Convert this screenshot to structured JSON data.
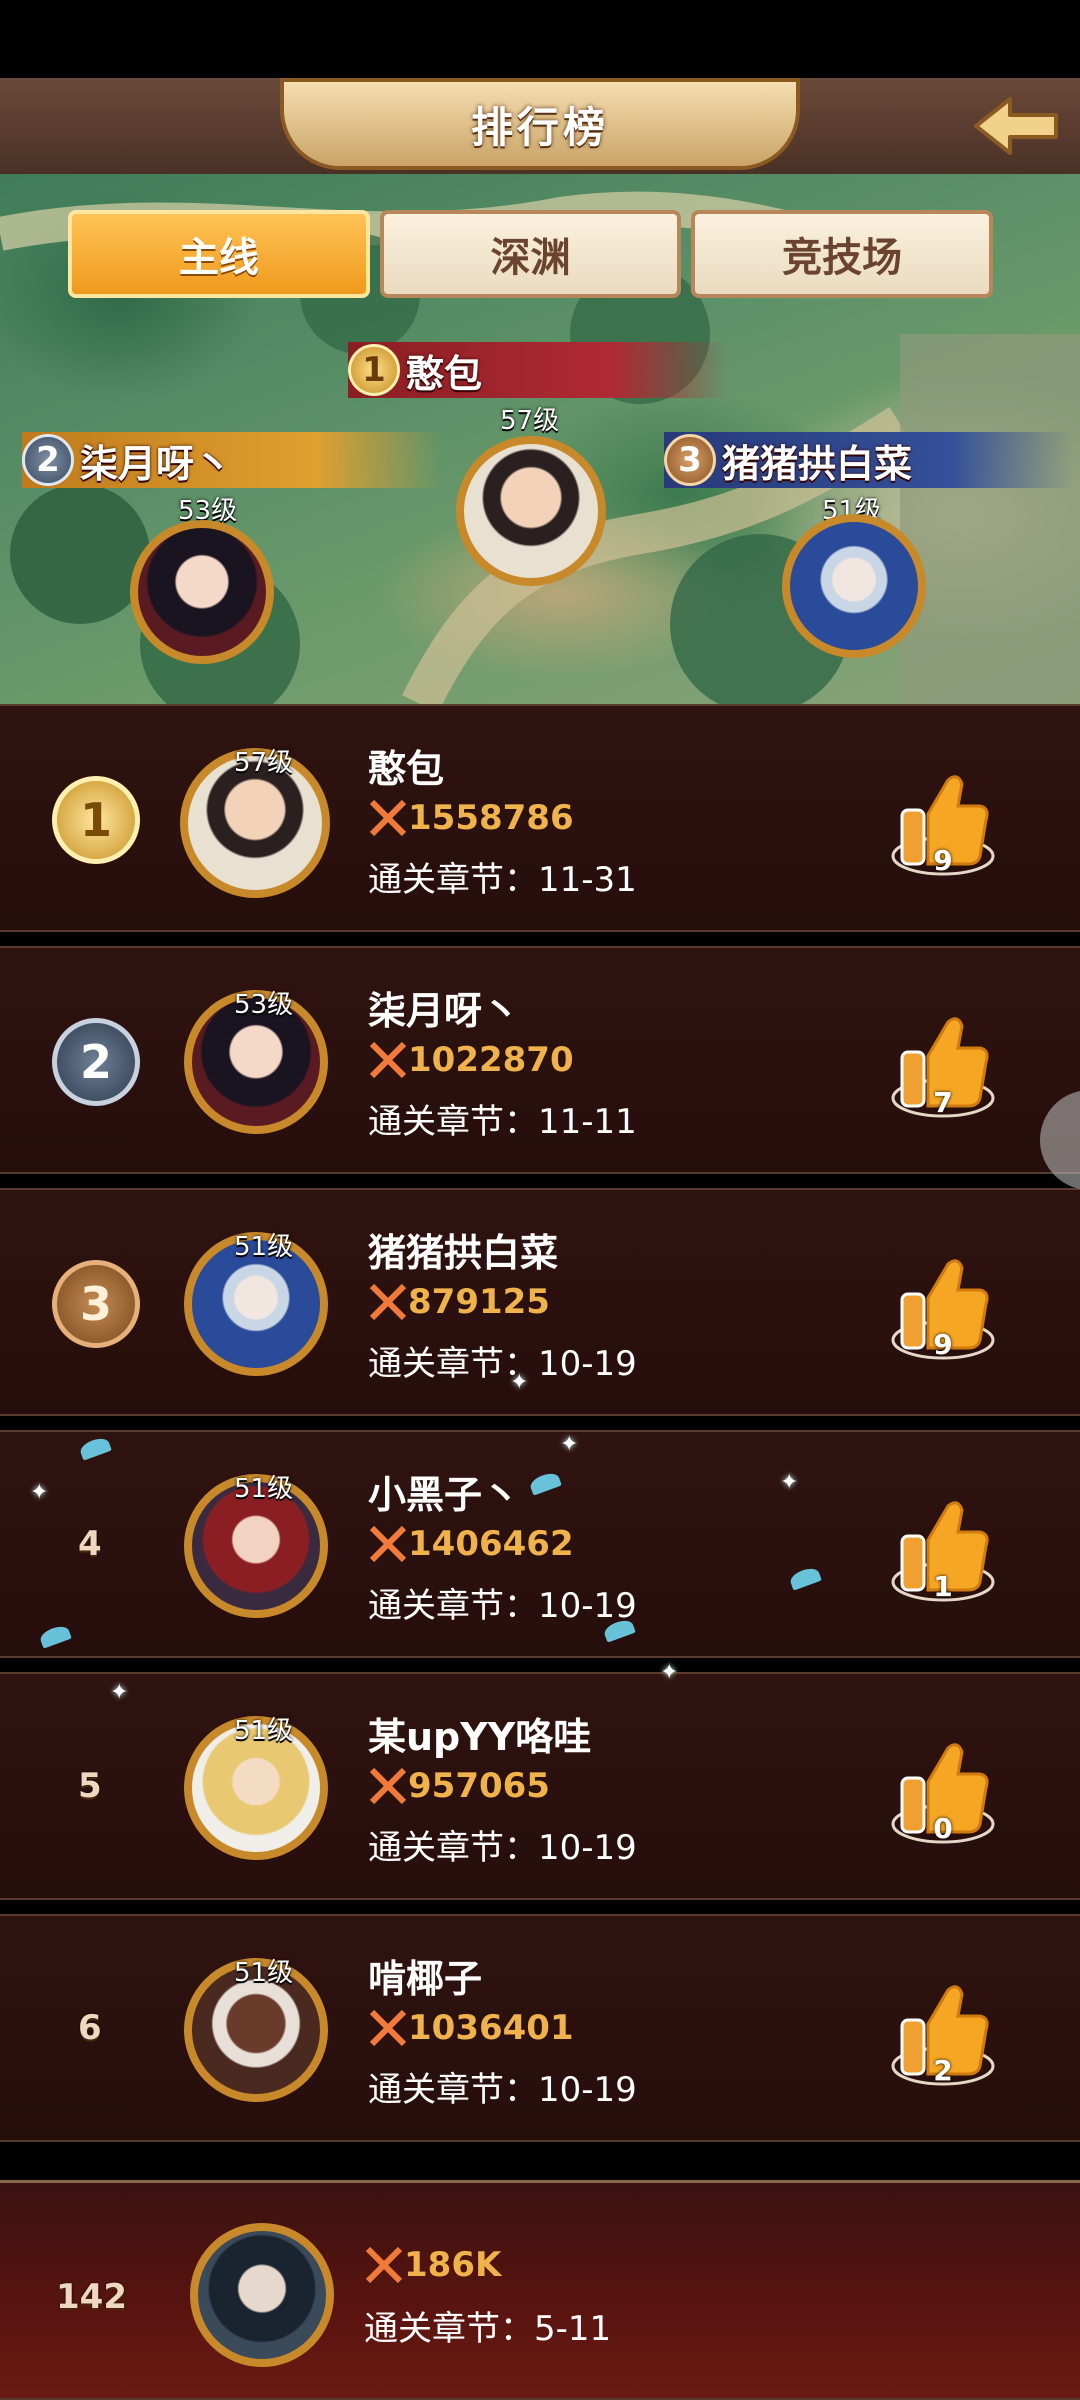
{
  "header": {
    "title": "排行榜"
  },
  "tabs": [
    {
      "label": "主线",
      "active": true
    },
    {
      "label": "深渊",
      "active": false
    },
    {
      "label": "竞技场",
      "active": false
    }
  ],
  "podium": [
    {
      "rank": "1",
      "name": "憨包",
      "level": "57级"
    },
    {
      "rank": "2",
      "name": "柒月呀丶",
      "level": "53级"
    },
    {
      "rank": "3",
      "name": "猪猪拱白菜",
      "level": "51级"
    }
  ],
  "rows": [
    {
      "rank": "1",
      "name": "憨包",
      "level": "57级",
      "power": "1558786",
      "chapter": "通关章节：11-31",
      "likes": "9"
    },
    {
      "rank": "2",
      "name": "柒月呀丶",
      "level": "53级",
      "power": "1022870",
      "chapter": "通关章节：11-11",
      "likes": "7"
    },
    {
      "rank": "3",
      "name": "猪猪拱白菜",
      "level": "51级",
      "power": "879125",
      "chapter": "通关章节：10-19",
      "likes": "9"
    },
    {
      "rank": "4",
      "name": "小黑子丶",
      "level": "51级",
      "power": "1406462",
      "chapter": "通关章节：10-19",
      "likes": "1"
    },
    {
      "rank": "5",
      "name": "某upYY咯哇",
      "level": "51级",
      "power": "957065",
      "chapter": "通关章节：10-19",
      "likes": "0"
    },
    {
      "rank": "6",
      "name": "啃椰子",
      "level": "51级",
      "power": "1036401",
      "chapter": "通关章节：10-19",
      "likes": "2"
    }
  ],
  "self": {
    "rank": "142",
    "power": "186K",
    "chapter": "通关章节：5-11"
  },
  "icons": {
    "back": "back-arrow-icon",
    "like": "thumbs-up-icon",
    "power": "crossed-swords-icon"
  },
  "colors": {
    "gold": "#f0b24a",
    "row_bg": "#2a1010",
    "tab_active": "#f5a623"
  }
}
